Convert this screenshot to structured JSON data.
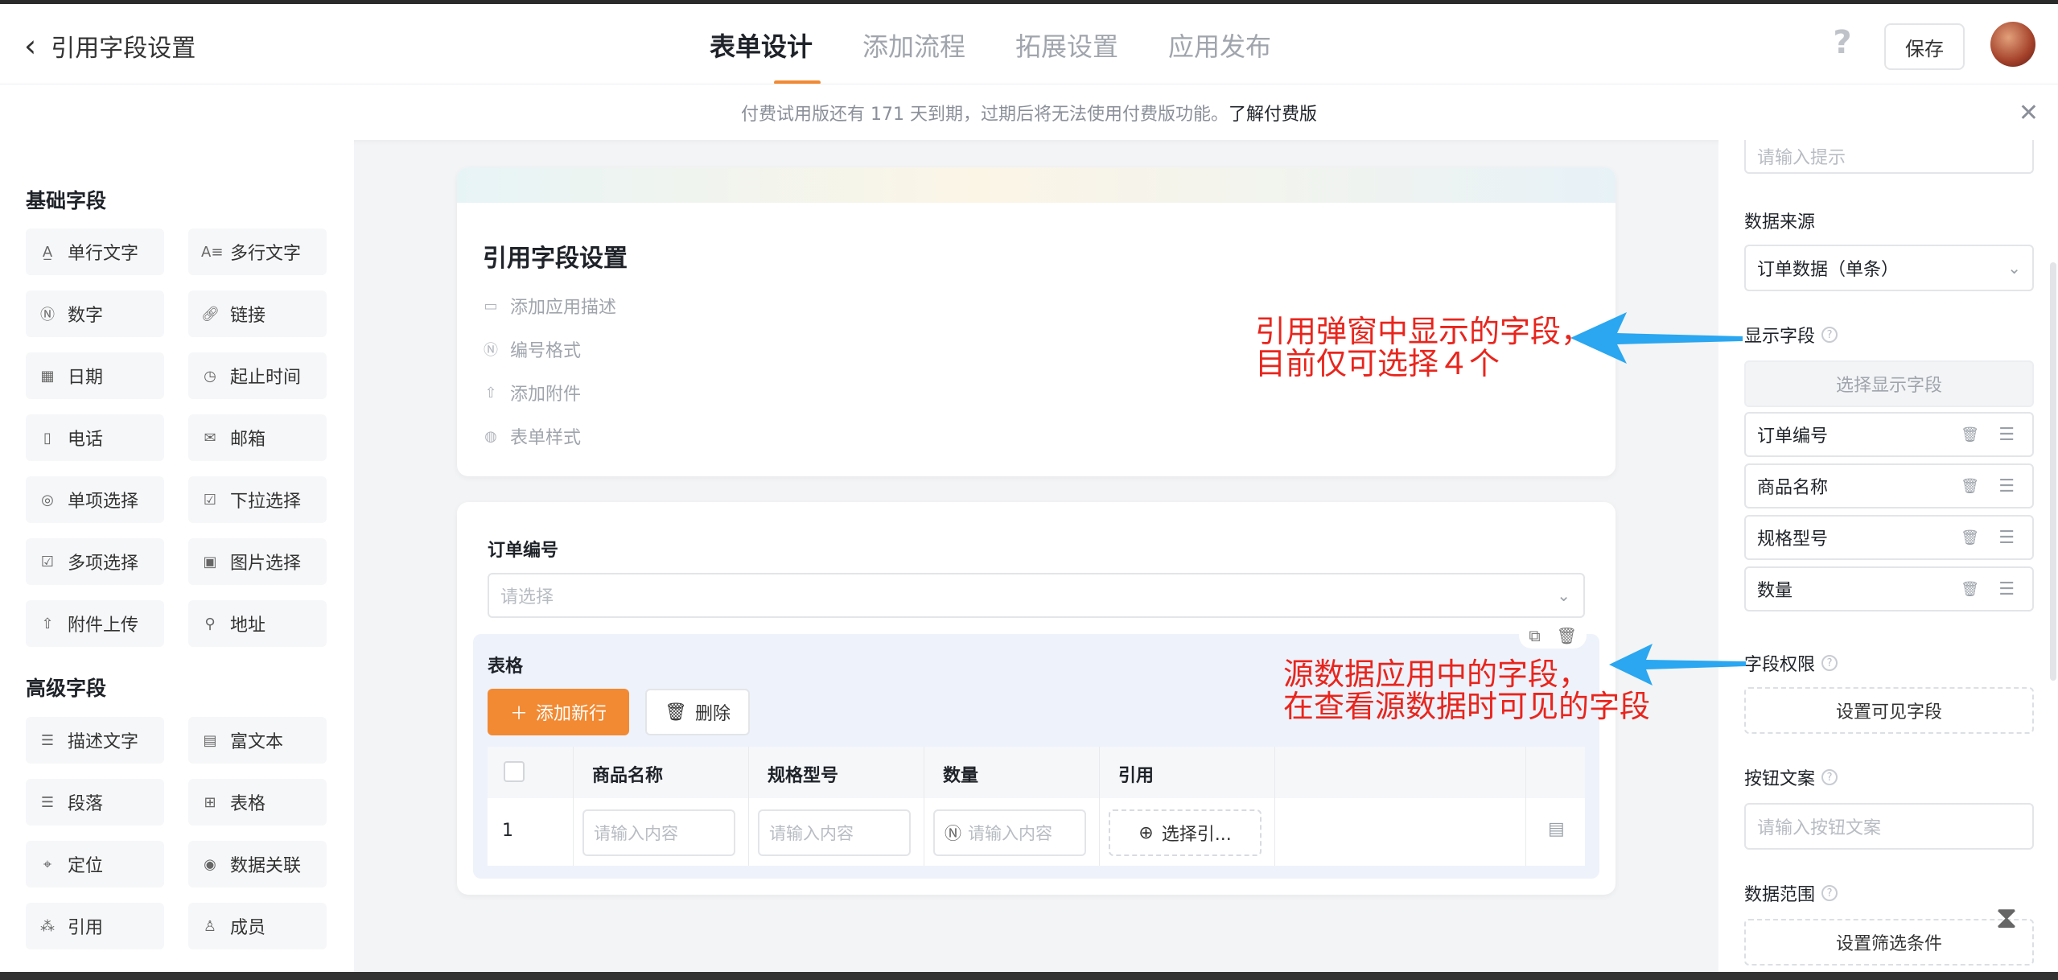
{
  "header": {
    "back_label": "引用字段设置",
    "tabs": [
      "表单设计",
      "添加流程",
      "拓展设置",
      "应用发布"
    ],
    "active_tab": "表单设计",
    "help": "?",
    "save_label": "保存"
  },
  "banner": {
    "text": "付费试用版还有 171 天到期，过期后将无法使用付费版功能。",
    "link": "了解付费版"
  },
  "left_panel": {
    "basic_title": "基础字段",
    "basic_fields": [
      {
        "icon": "text-icon",
        "label": "单行文字"
      },
      {
        "icon": "multiline-icon",
        "label": "多行文字"
      },
      {
        "icon": "number-icon",
        "label": "数字"
      },
      {
        "icon": "link-icon",
        "label": "链接"
      },
      {
        "icon": "calendar-icon",
        "label": "日期"
      },
      {
        "icon": "time-range-icon",
        "label": "起止时间"
      },
      {
        "icon": "phone-icon",
        "label": "电话"
      },
      {
        "icon": "mail-icon",
        "label": "邮箱"
      },
      {
        "icon": "radio-icon",
        "label": "单项选择"
      },
      {
        "icon": "dropdown-icon",
        "label": "下拉选择"
      },
      {
        "icon": "checkbox-icon",
        "label": "多项选择"
      },
      {
        "icon": "image-icon",
        "label": "图片选择"
      },
      {
        "icon": "upload-icon",
        "label": "附件上传"
      },
      {
        "icon": "address-icon",
        "label": "地址"
      }
    ],
    "advanced_title": "高级字段",
    "advanced_fields": [
      {
        "icon": "description-icon",
        "label": "描述文字"
      },
      {
        "icon": "richtext-icon",
        "label": "富文本"
      },
      {
        "icon": "paragraph-icon",
        "label": "段落"
      },
      {
        "icon": "table-icon",
        "label": "表格"
      },
      {
        "icon": "location-icon",
        "label": "定位"
      },
      {
        "icon": "data-link-icon",
        "label": "数据关联"
      },
      {
        "icon": "reference-icon",
        "label": "引用"
      },
      {
        "icon": "member-icon",
        "label": "成员"
      }
    ]
  },
  "form": {
    "title": "引用字段设置",
    "options": [
      "添加应用描述",
      "编号格式",
      "添加附件",
      "表单样式"
    ],
    "order_label": "订单编号",
    "order_placeholder": "请选择",
    "table_label": "表格",
    "add_row_label": "添加新行",
    "delete_label": "删除",
    "columns": [
      "商品名称",
      "规格型号",
      "数量",
      "引用"
    ],
    "row_index": "1",
    "input_placeholder": "请输入内容",
    "pick_label": "选择引..."
  },
  "right_panel": {
    "hint_placeholder": "请输入提示",
    "data_source_label": "数据来源",
    "data_source_value": "订单数据（单条）",
    "display_fields_label": "显示字段",
    "select_display_button": "选择显示字段",
    "display_fields": [
      "订单编号",
      "商品名称",
      "规格型号",
      "数量"
    ],
    "permission_label": "字段权限",
    "permission_button": "设置可见字段",
    "button_text_label": "按钮文案",
    "button_text_placeholder": "请输入按钮文案",
    "data_range_label": "数据范围",
    "data_range_button": "设置筛选条件"
  },
  "annotations": {
    "note1_line1": "引用弹窗中显示的字段，",
    "note1_line2": "目前仅可选择４个",
    "note2_line1": "源数据应用中的字段，",
    "note2_line2": "在查看源数据时可见的字段",
    "color": "#e8251d",
    "arrow_color": "#2aa7f0"
  },
  "colors": {
    "accent": "#f28a33"
  }
}
